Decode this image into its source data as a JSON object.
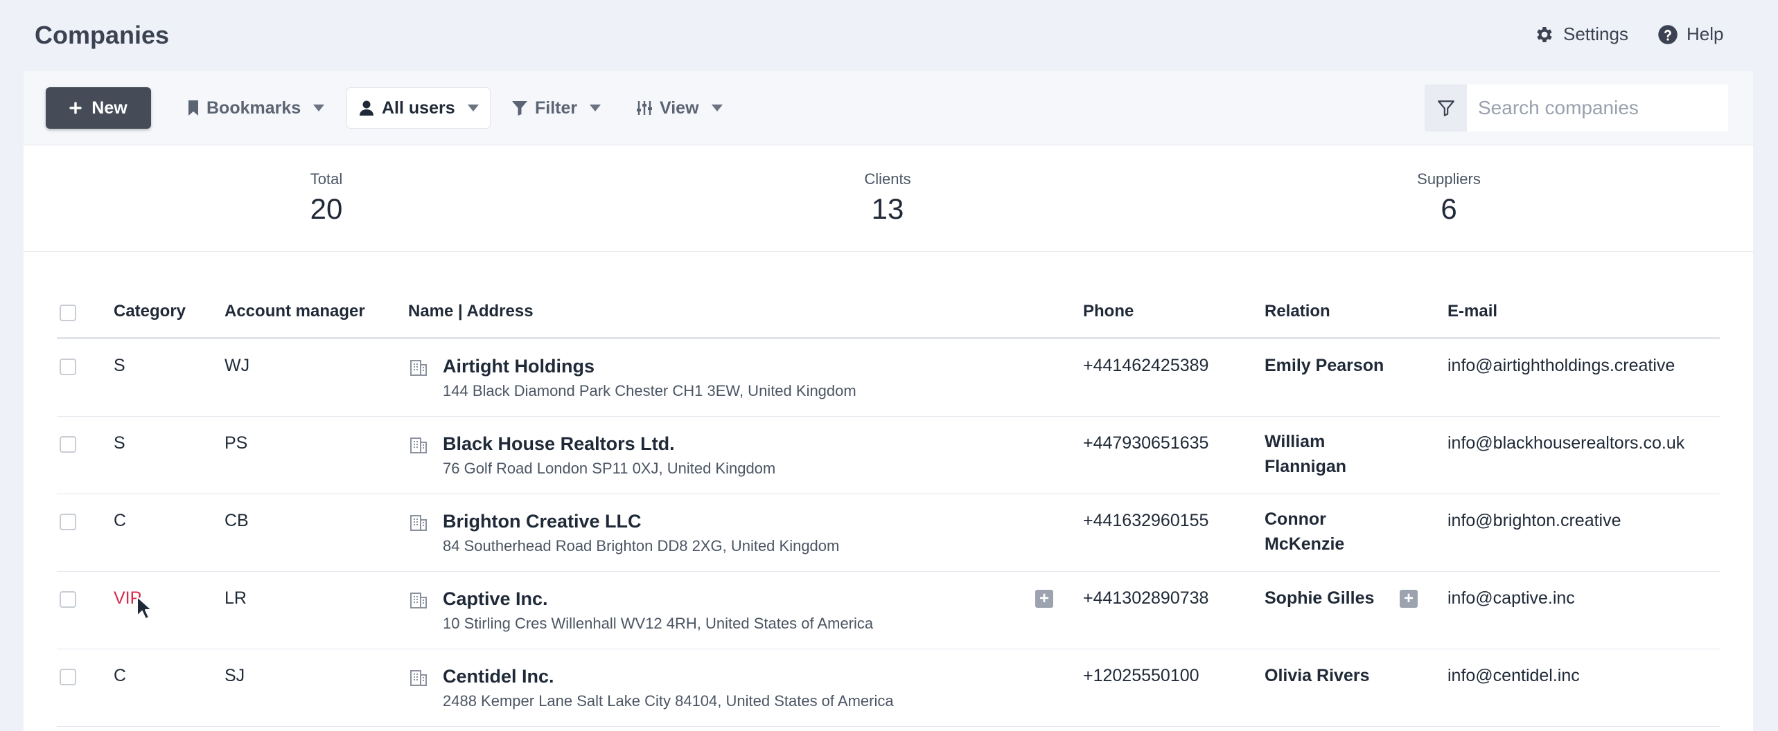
{
  "header": {
    "title": "Companies",
    "settings_label": "Settings",
    "help_label": "Help"
  },
  "toolbar": {
    "new_label": "New",
    "bookmarks_label": "Bookmarks",
    "users_label": "All users",
    "filter_label": "Filter",
    "view_label": "View",
    "search_placeholder": "Search companies"
  },
  "stats": [
    {
      "label": "Total",
      "value": "20"
    },
    {
      "label": "Clients",
      "value": "13"
    },
    {
      "label": "Suppliers",
      "value": "6"
    }
  ],
  "table": {
    "columns": [
      "Category",
      "Account manager",
      "Name | Address",
      "Phone",
      "Relation",
      "E-mail"
    ],
    "rows": [
      {
        "category": "S",
        "manager": "WJ",
        "name": "Airtight Holdings",
        "address": "144 Black Diamond Park Chester CH1 3EW, United Kingdom",
        "phone": "+441462425389",
        "relation": "Emily Pearson",
        "email": "info@airtightholdings.creative"
      },
      {
        "category": "S",
        "manager": "PS",
        "name": "Black House Realtors Ltd.",
        "address": "76 Golf Road London SP11 0XJ, United Kingdom",
        "phone": "+447930651635",
        "relation_1": "William",
        "relation_2": "Flannigan",
        "email": "info@blackhouserealtors.co.uk"
      },
      {
        "category": "C",
        "manager": "CB",
        "name": "Brighton Creative LLC",
        "address": "84 Southerhead Road Brighton DD8 2XG, United Kingdom",
        "phone": "+441632960155",
        "relation_1": "Connor",
        "relation_2": "McKenzie",
        "email": "info@brighton.creative"
      },
      {
        "category": "VIP",
        "manager": "LR",
        "name": "Captive Inc.",
        "address": "10 Stirling Cres Willenhall WV12 4RH, United States of America",
        "phone": "+441302890738",
        "relation": "Sophie Gilles",
        "email": "info@captive.inc",
        "plus": "+"
      },
      {
        "category": "C",
        "manager": "SJ",
        "name": "Centidel Inc.",
        "address": "2488 Kemper Lane Salt Lake City 84104, United States of America",
        "phone": "+12025550100",
        "relation": "Olivia Rivers",
        "email": "info@centidel.inc"
      }
    ]
  },
  "colors": {
    "vip": "#d7294a",
    "primary_button": "#454c57",
    "toolbar_bg": "#f5f7fb",
    "page_bg": "#eef1f7"
  },
  "icons": [
    "gear-icon",
    "help-icon",
    "plus-icon",
    "bookmark-icon",
    "user-icon",
    "filter-icon",
    "sliders-icon",
    "building-icon",
    "cursor-icon"
  ]
}
